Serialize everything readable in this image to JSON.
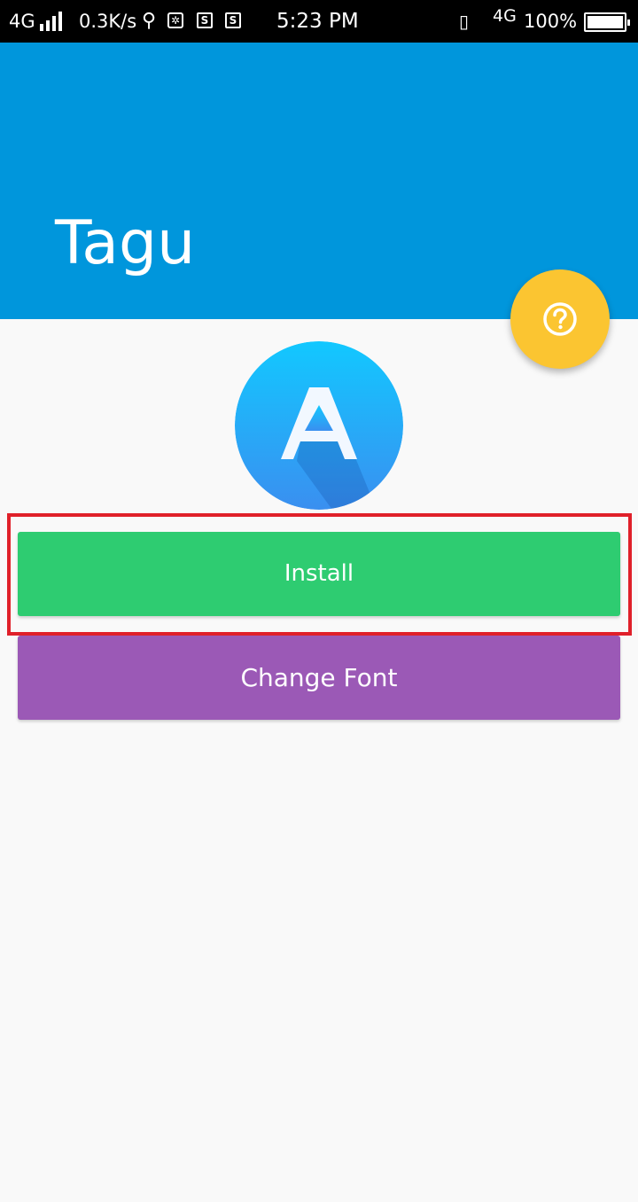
{
  "status_bar": {
    "network_left": "4G",
    "speed": "0.3K/s",
    "time": "5:23 PM",
    "network_right": "4G",
    "battery": "100%",
    "icons": [
      "signal-icon",
      "usb-icon",
      "app-icon",
      "s-notification-icon",
      "vibrate-icon",
      "battery-icon"
    ]
  },
  "header": {
    "title": "Tagu",
    "color": "#0096dc"
  },
  "fab": {
    "icon": "help-icon",
    "color": "#fbc531"
  },
  "logo": {
    "letter": "A",
    "icon": "app-logo-icon"
  },
  "buttons": {
    "install_label": "Install",
    "install_color": "#2ecc71",
    "change_font_label": "Change Font",
    "change_font_color": "#9b59b6"
  },
  "highlight_color": "#e0202a"
}
